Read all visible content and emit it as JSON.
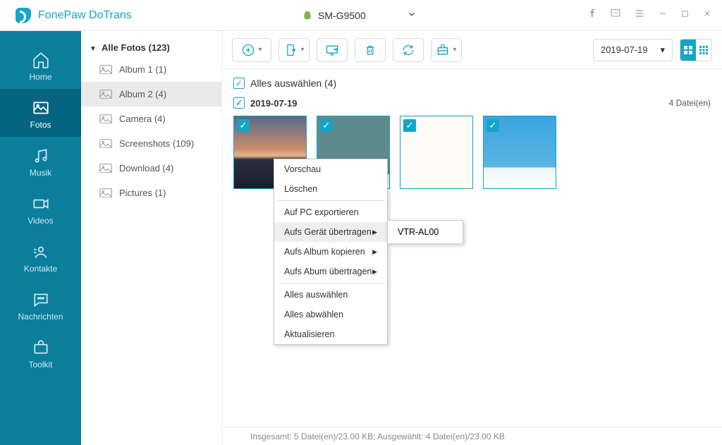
{
  "app": {
    "title": "FonePaw DoTrans"
  },
  "device": {
    "name": "SM-G9500"
  },
  "nav": {
    "home": "Home",
    "fotos": "Fotos",
    "musik": "Musik",
    "videos": "Videos",
    "kontakte": "Kontakte",
    "nachrichten": "Nachrichten",
    "toolkit": "Toolkit"
  },
  "sidebar": {
    "header": "Alle Fotos (123)",
    "items": [
      {
        "label": "Album 1 (1)"
      },
      {
        "label": "Album 2 (4)"
      },
      {
        "label": "Camera (4)"
      },
      {
        "label": "Screenshots (109)"
      },
      {
        "label": "Download (4)"
      },
      {
        "label": "Pictures (1)"
      }
    ]
  },
  "toolbar": {
    "date_filter": "2019-07-19"
  },
  "selectall": {
    "label": "Alles auswählen (4)"
  },
  "group": {
    "date": "2019-07-19",
    "count_label": "4 Datei(en)"
  },
  "context_menu": {
    "preview": "Vorschau",
    "delete": "Löschen",
    "export_pc": "Auf PC exportieren",
    "transfer_device": "Aufs Gerät übertragen",
    "copy_album": "Aufs Album kopieren",
    "transfer_album": "Aufs Abum übertragen",
    "select_all": "Alles auswählen",
    "deselect_all": "Alles abwählen",
    "refresh": "Aktualisieren",
    "submenu_device": "VTR-AL00"
  },
  "status": {
    "text": "Insgesamt: 5 Datei(en)/23.00 KB; Ausgewählt: 4 Datei(en)/23.00 KB"
  }
}
